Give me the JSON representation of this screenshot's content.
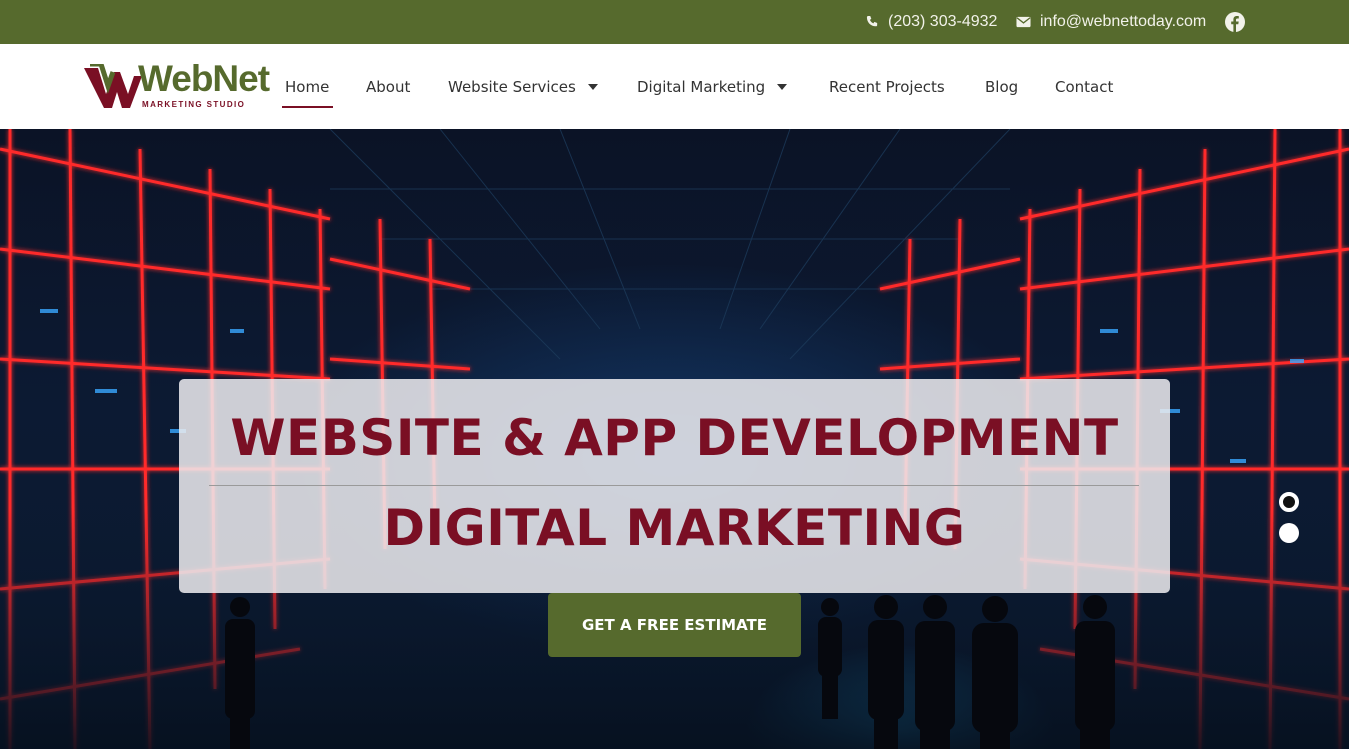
{
  "topbar": {
    "phone": "(203) 303-4932",
    "email": "info@webnettoday.com",
    "phone_icon": "phone-icon",
    "email_icon": "envelope-icon",
    "social_icon": "facebook-icon"
  },
  "logo": {
    "word": "WebNet",
    "tagline": "MARKETING STUDIO"
  },
  "nav": {
    "items": [
      {
        "label": "Home",
        "active": true
      },
      {
        "label": "About"
      },
      {
        "label": "Website Services",
        "dropdown": true
      },
      {
        "label": "Digital Marketing",
        "dropdown": true
      },
      {
        "label": "Recent Projects"
      },
      {
        "label": "Blog"
      },
      {
        "label": "Contact"
      }
    ]
  },
  "hero": {
    "headline1": "WEBSITE & APP DEVELOPMENT",
    "headline2": "DIGITAL MARKETING",
    "cta": "GET A FREE ESTIMATE",
    "slides_total": 2,
    "slide_active": 1
  },
  "colors": {
    "brand_green": "#566a2d",
    "brand_maroon": "#7a0f24",
    "neon_red": "#ff2a2a"
  }
}
